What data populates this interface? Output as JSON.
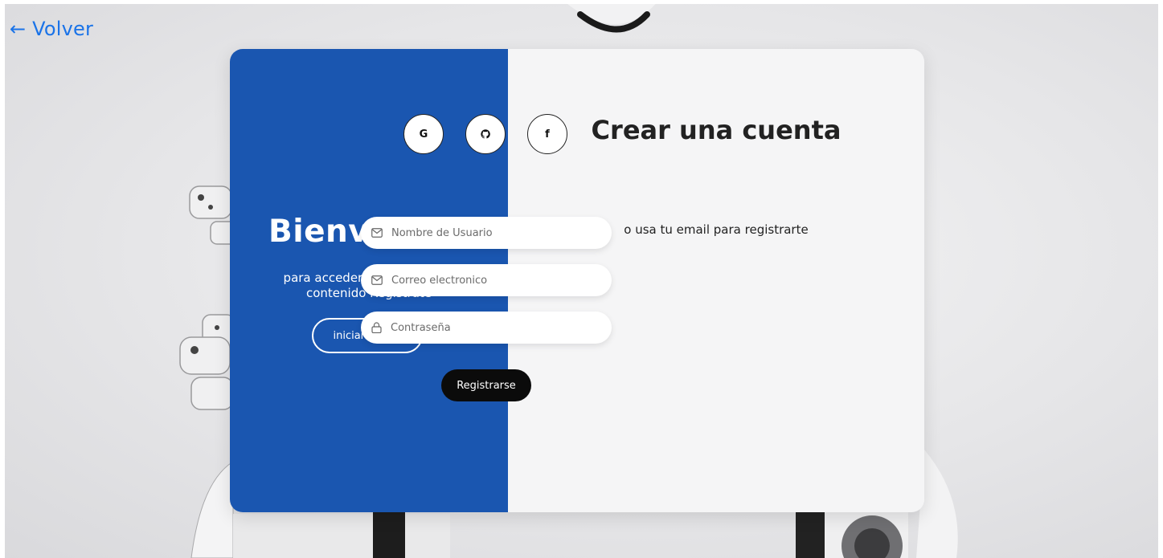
{
  "nav": {
    "back_label": "← Volver"
  },
  "welcome": {
    "title": "Bienvenido",
    "subtitle": "para acceder a todo nuestro contenido Registrate",
    "signin_label": "iniciar sesión"
  },
  "signup": {
    "title": "Crear una cuenta",
    "social": [
      {
        "label": "G",
        "icon": "google-icon"
      },
      {
        "label": "",
        "icon": "github-icon"
      },
      {
        "label": "f",
        "icon": "facebook-icon"
      }
    ],
    "alt_text": "o usa tu email para registrarte",
    "fields": {
      "username": {
        "placeholder": "Nombre de Usuario",
        "icon": "mail-icon"
      },
      "email": {
        "placeholder": "Correo electronico",
        "icon": "mail-icon"
      },
      "password": {
        "placeholder": "Contraseña",
        "icon": "lock-icon"
      }
    },
    "submit_label": "Registrarse"
  },
  "colors": {
    "panel_blue": "#1a56b0",
    "link_blue": "#1a73e8",
    "button_dark": "#0b0b0b",
    "form_bg": "#f5f5f6"
  }
}
